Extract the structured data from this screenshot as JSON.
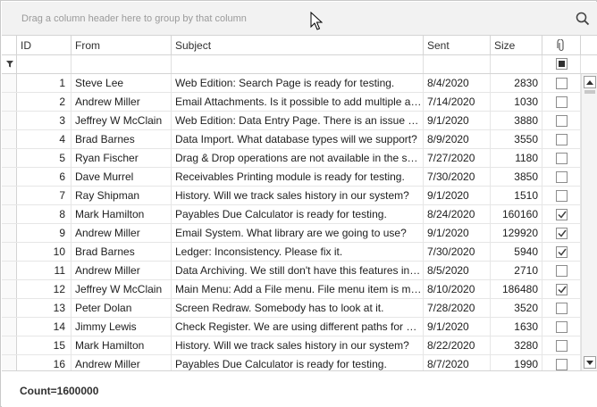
{
  "group_panel": {
    "hint": "Drag a column header here to group by that column"
  },
  "columns": [
    {
      "key": "id",
      "label": "ID"
    },
    {
      "key": "from",
      "label": "From"
    },
    {
      "key": "subject",
      "label": "Subject"
    },
    {
      "key": "sent",
      "label": "Sent"
    },
    {
      "key": "size",
      "label": "Size"
    },
    {
      "key": "attachment",
      "label": "",
      "icon": "paperclip-icon"
    }
  ],
  "rows": [
    {
      "id": "1",
      "from": "Steve Lee",
      "subject": "Web Edition: Search Page is ready for testing.",
      "sent": "8/4/2020",
      "size": "2830",
      "attachment": false
    },
    {
      "id": "2",
      "from": "Andrew Miller",
      "subject": "Email Attachments. Is it possible to add multiple attachments?",
      "sent": "7/14/2020",
      "size": "1030",
      "attachment": false
    },
    {
      "id": "3",
      "from": "Jeffrey W McClain",
      "subject": "Web Edition: Data Entry Page. There is an issue with the page.",
      "sent": "9/1/2020",
      "size": "3880",
      "attachment": false
    },
    {
      "id": "4",
      "from": "Brad Barnes",
      "subject": "Data Import. What database types will we support?",
      "sent": "8/9/2020",
      "size": "3550",
      "attachment": false
    },
    {
      "id": "5",
      "from": "Ryan Fischer",
      "subject": "Drag & Drop operations are not available in the scheduler.",
      "sent": "7/27/2020",
      "size": "1180",
      "attachment": false
    },
    {
      "id": "6",
      "from": "Dave Murrel",
      "subject": "Receivables Printing module is ready for testing.",
      "sent": "7/30/2020",
      "size": "3850",
      "attachment": false
    },
    {
      "id": "7",
      "from": "Ray Shipman",
      "subject": "History. Will we track sales history in our system?",
      "sent": "9/1/2020",
      "size": "1510",
      "attachment": false
    },
    {
      "id": "8",
      "from": "Mark Hamilton",
      "subject": "Payables Due Calculator is ready for testing.",
      "sent": "8/24/2020",
      "size": "160160",
      "attachment": true
    },
    {
      "id": "9",
      "from": "Andrew Miller",
      "subject": "Email System. What library are we going to use?",
      "sent": "9/1/2020",
      "size": "129920",
      "attachment": true
    },
    {
      "id": "10",
      "from": "Brad Barnes",
      "subject": "Ledger: Inconsistency. Please fix it.",
      "sent": "7/30/2020",
      "size": "5940",
      "attachment": true
    },
    {
      "id": "11",
      "from": "Andrew Miller",
      "subject": "Data Archiving. We still don't have this features in our application.",
      "sent": "8/5/2020",
      "size": "2710",
      "attachment": false
    },
    {
      "id": "12",
      "from": "Jeffrey W McClain",
      "subject": "Main Menu: Add a File menu. File menu item is missing.",
      "sent": "8/10/2020",
      "size": "186480",
      "attachment": true
    },
    {
      "id": "13",
      "from": "Peter Dolan",
      "subject": "Screen Redraw. Somebody has to look at it.",
      "sent": "7/28/2020",
      "size": "3520",
      "attachment": false
    },
    {
      "id": "14",
      "from": "Jimmy Lewis",
      "subject": "Check Register. We are using different paths for different modules.",
      "sent": "9/1/2020",
      "size": "1630",
      "attachment": false
    },
    {
      "id": "15",
      "from": "Mark Hamilton",
      "subject": "History. Will we track sales history in our system?",
      "sent": "8/22/2020",
      "size": "3280",
      "attachment": false
    },
    {
      "id": "16",
      "from": "Andrew Miller",
      "subject": "Payables Due Calculator is ready for testing.",
      "sent": "8/7/2020",
      "size": "1990",
      "attachment": false
    }
  ],
  "footer": {
    "count": "Count=1600000"
  },
  "colors": {
    "border": "#d4d4d4",
    "group_panel_bg": "#f2f2f2",
    "check_mark": "#404040"
  }
}
